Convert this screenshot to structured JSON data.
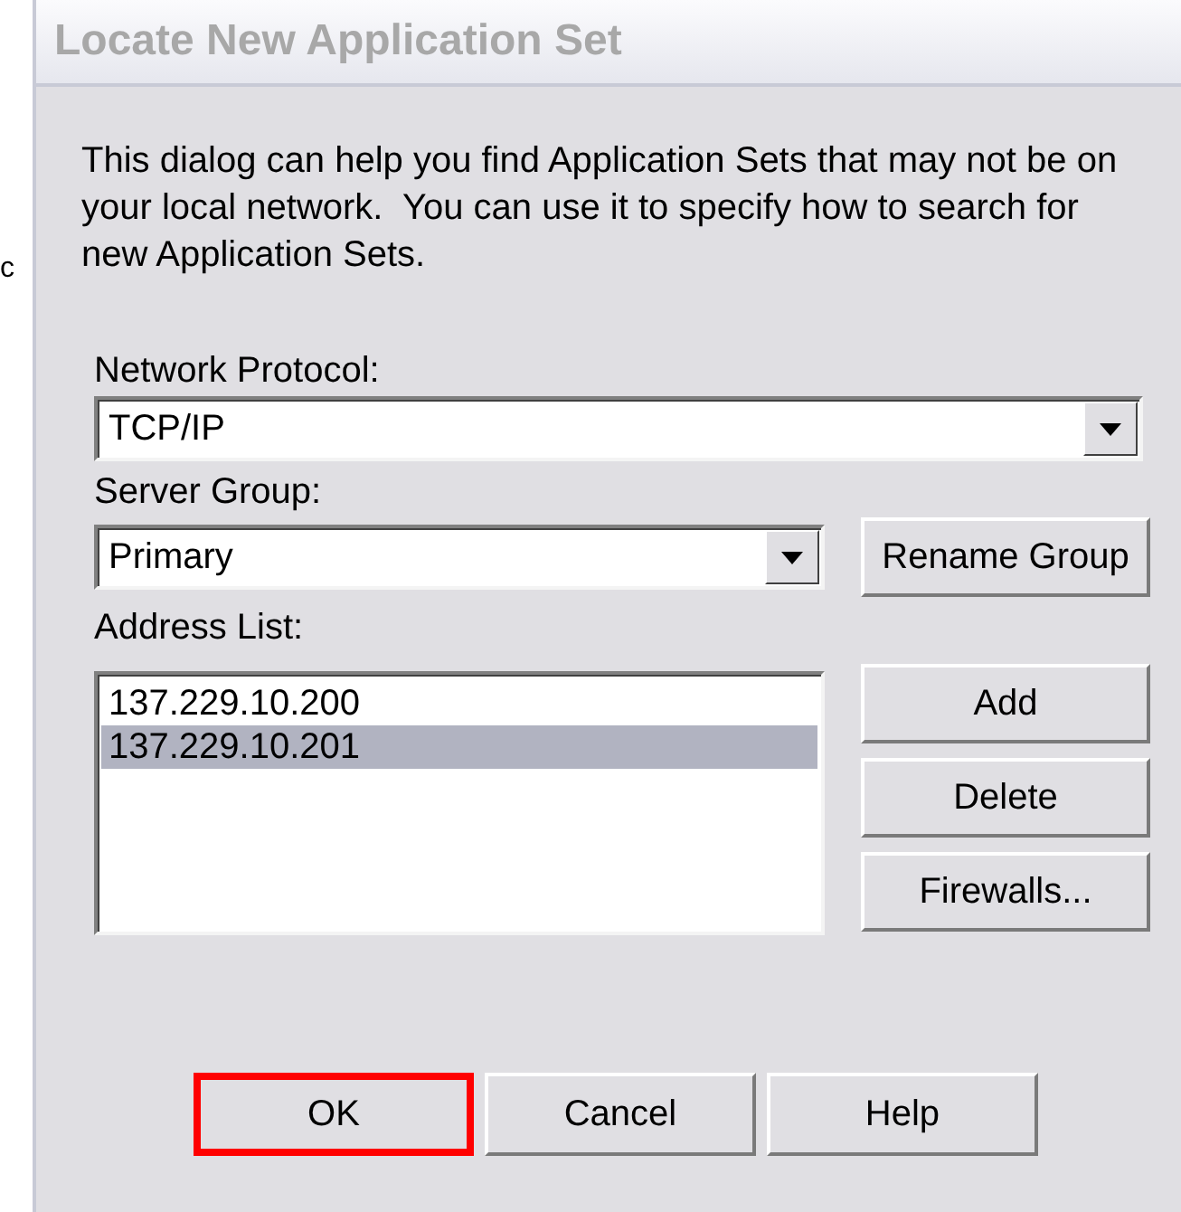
{
  "margin_fragment": "c",
  "window": {
    "title": "Locate New Application Set",
    "active": false
  },
  "intro": "This dialog can help you find Application Sets that may not be on your local network.  You can use it to specify how to search for new Application Sets.",
  "network_protocol": {
    "label": "Network Protocol:",
    "value": "TCP/IP"
  },
  "server_group": {
    "label": "Server Group:",
    "value": "Primary",
    "button": "Rename Group"
  },
  "address_list": {
    "label": "Address List:",
    "items": [
      {
        "text": "137.229.10.200",
        "selected": false
      },
      {
        "text": "137.229.10.201",
        "selected": true
      }
    ],
    "buttons": [
      "Add",
      "Delete",
      "Firewalls..."
    ]
  },
  "buttons": [
    {
      "label": "OK",
      "highlighted": true
    },
    {
      "label": "Cancel",
      "highlighted": false
    },
    {
      "label": "Help",
      "highlighted": false
    }
  ]
}
